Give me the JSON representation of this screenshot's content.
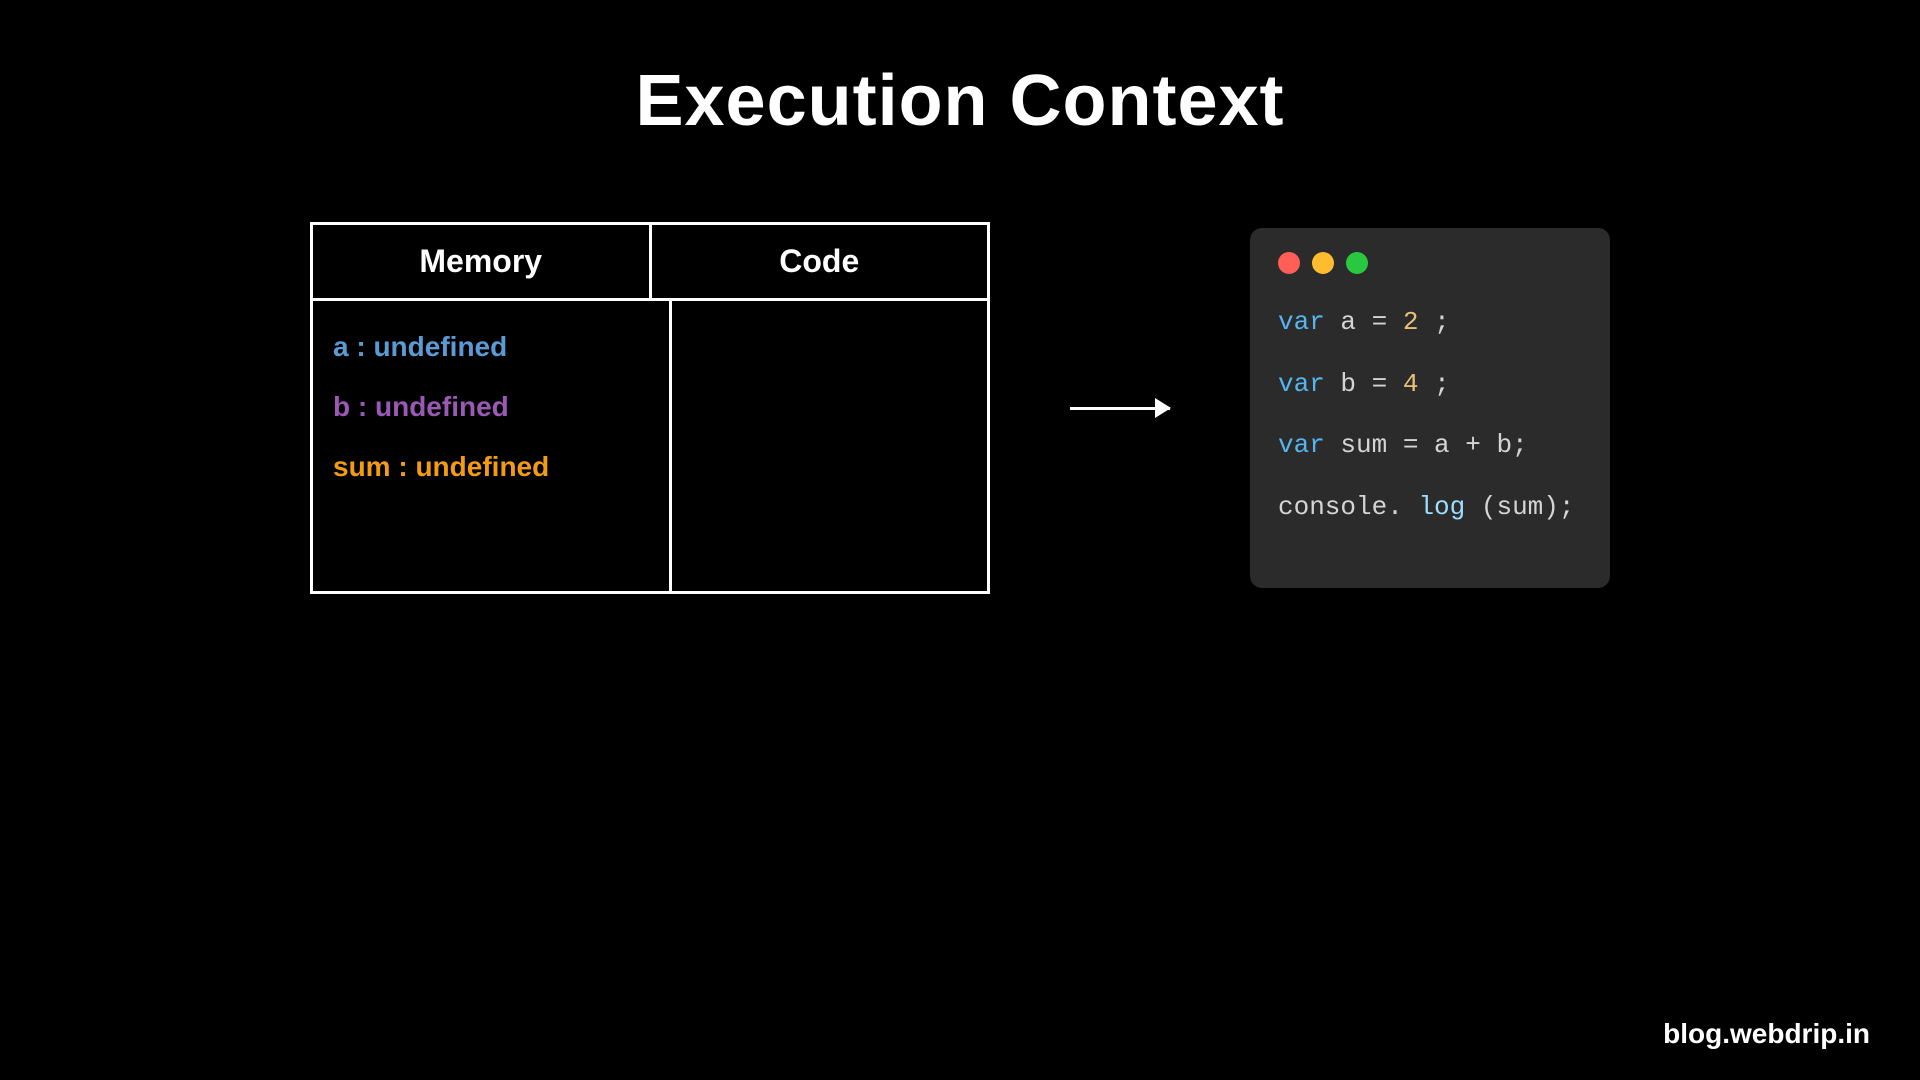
{
  "page": {
    "title": "Execution Context",
    "background": "#000000"
  },
  "table": {
    "memory_header": "Memory",
    "code_header": "Code",
    "memory_items": [
      {
        "label": "a : undefined",
        "color_class": "a-item"
      },
      {
        "label": "b : undefined",
        "color_class": "b-item"
      },
      {
        "label": "sum : undefined",
        "color_class": "sum-item"
      }
    ]
  },
  "code_editor": {
    "dots": [
      {
        "color": "red",
        "label": "close"
      },
      {
        "color": "yellow",
        "label": "minimize"
      },
      {
        "color": "green",
        "label": "maximize"
      }
    ],
    "lines": [
      {
        "text": "var a = 2;",
        "gap": true
      },
      {
        "text": "var b = 4;",
        "gap": true
      },
      {
        "text": "var sum = a + b;",
        "gap": true
      },
      {
        "text": "console.log(sum);",
        "gap": false
      }
    ]
  },
  "watermark": {
    "text": "blog.webdrip.in"
  }
}
